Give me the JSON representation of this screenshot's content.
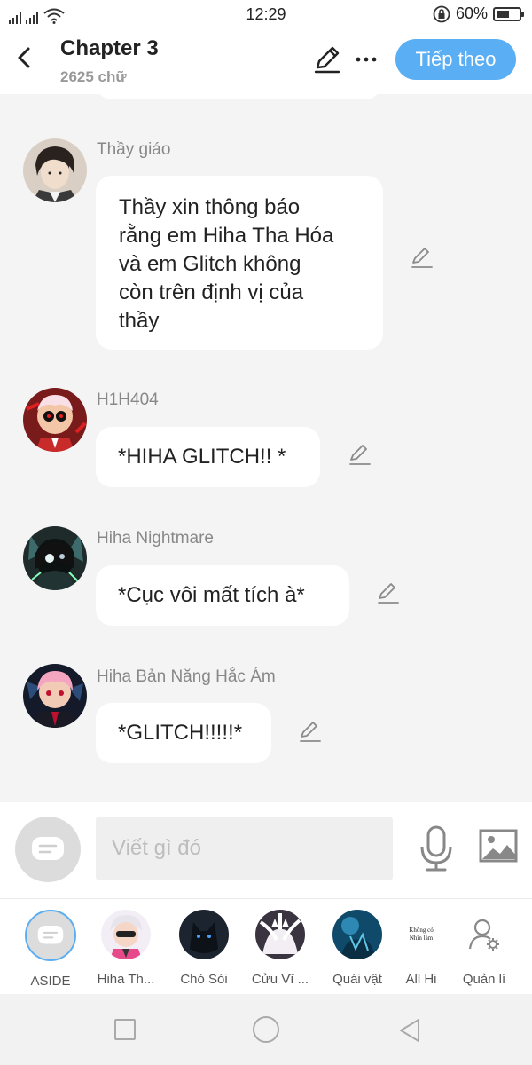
{
  "status_bar": {
    "time": "12:29",
    "battery_text": "60%",
    "battery_level": 0.6
  },
  "header": {
    "title": "Chapter 3",
    "word_count": "2625 chữ",
    "next_label": "Tiếp theo",
    "icons": [
      "back-icon",
      "pencil-icon",
      "more-icon"
    ],
    "accent_color": "#5aaef3"
  },
  "messages": [
    {
      "name": "Thầy giáo",
      "lines": [
        "Thầy xin thông báo",
        "rằng em Hiha Tha Hóa",
        "và em Glitch không",
        "còn trên định vị của",
        "thầy"
      ]
    },
    {
      "name": "H1H404",
      "lines": [
        "*HIHA GLITCH!! *"
      ]
    },
    {
      "name": "Hiha Nightmare",
      "lines": [
        "*Cục vôi mất tích à*"
      ]
    },
    {
      "name": "Hiha Bản Năng Hắc Ám",
      "lines": [
        "*GLITCH!!!!!*"
      ]
    }
  ],
  "composer": {
    "placeholder": "Viết gì đó",
    "icons": [
      "aside-icon",
      "mic-icon",
      "image-icon"
    ]
  },
  "characters": [
    {
      "label": "ASIDE"
    },
    {
      "label": "Hiha Th..."
    },
    {
      "label": "Chó Sói"
    },
    {
      "label": "Cửu Vĩ ..."
    },
    {
      "label": "Quái vật"
    },
    {
      "label": "All Hi",
      "avatar_text": "Không có Nhìn làm"
    },
    {
      "label": "Quản lí"
    }
  ],
  "nav": {
    "icons": [
      "recent-apps-icon",
      "home-icon",
      "back-nav-icon"
    ]
  }
}
